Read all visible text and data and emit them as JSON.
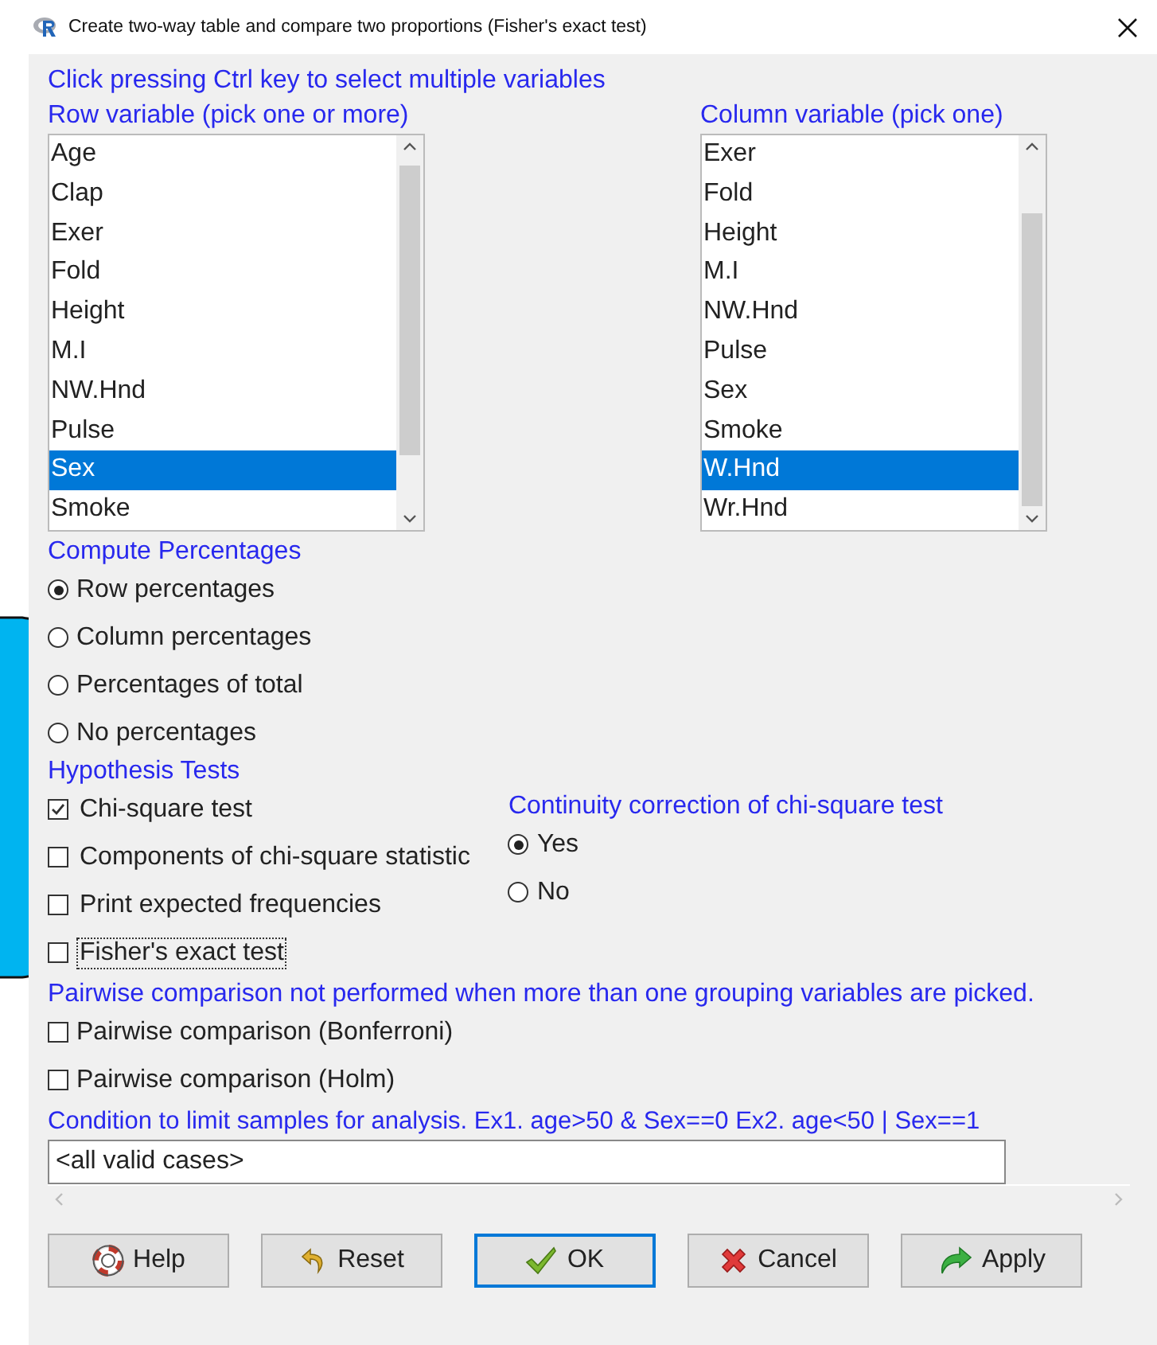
{
  "window": {
    "title": "Create two-way table and compare two proportions (Fisher's exact test)"
  },
  "instruction": "Click pressing Ctrl key to select multiple variables",
  "row_variable": {
    "label": "Row variable (pick one or more)",
    "items": [
      {
        "label": "Age",
        "selected": false
      },
      {
        "label": "Clap",
        "selected": false
      },
      {
        "label": "Exer",
        "selected": false
      },
      {
        "label": "Fold",
        "selected": false
      },
      {
        "label": "Height",
        "selected": false
      },
      {
        "label": "M.I",
        "selected": false
      },
      {
        "label": "NW.Hnd",
        "selected": false
      },
      {
        "label": "Pulse",
        "selected": false
      },
      {
        "label": "Sex",
        "selected": true
      },
      {
        "label": "Smoke",
        "selected": false
      }
    ]
  },
  "column_variable": {
    "label": "Column variable (pick one)",
    "items": [
      {
        "label": "Exer",
        "selected": false
      },
      {
        "label": "Fold",
        "selected": false
      },
      {
        "label": "Height",
        "selected": false
      },
      {
        "label": "M.I",
        "selected": false
      },
      {
        "label": "NW.Hnd",
        "selected": false
      },
      {
        "label": "Pulse",
        "selected": false
      },
      {
        "label": "Sex",
        "selected": false
      },
      {
        "label": "Smoke",
        "selected": false
      },
      {
        "label": "W.Hnd",
        "selected": true
      },
      {
        "label": "Wr.Hnd",
        "selected": false
      }
    ]
  },
  "percentages": {
    "label": "Compute Percentages",
    "options": [
      {
        "label": "Row percentages",
        "selected": true
      },
      {
        "label": "Column percentages",
        "selected": false
      },
      {
        "label": "Percentages of total",
        "selected": false
      },
      {
        "label": "No percentages",
        "selected": false
      }
    ]
  },
  "hypothesis": {
    "label": "Hypothesis Tests",
    "tests": [
      {
        "label": "Chi-square test",
        "checked": true,
        "focused": false
      },
      {
        "label": "Components of chi-square statistic",
        "checked": false,
        "focused": false
      },
      {
        "label": "Print expected frequencies",
        "checked": false,
        "focused": false
      },
      {
        "label": "Fisher's exact test",
        "checked": false,
        "focused": true
      }
    ]
  },
  "continuity": {
    "label": "Continuity correction of chi-square test",
    "options": [
      {
        "label": "Yes",
        "selected": true
      },
      {
        "label": "No",
        "selected": false
      }
    ]
  },
  "pairwise_note": "Pairwise comparison not performed when more than one grouping variables are picked.",
  "pairwise": [
    {
      "label": "Pairwise comparison (Bonferroni)",
      "checked": false
    },
    {
      "label": "Pairwise comparison (Holm)",
      "checked": false
    }
  ],
  "condition": {
    "label": "Condition to limit samples for analysis. Ex1. age>50 & Sex==0  Ex2. age<50 | Sex==1",
    "value": "<all valid cases>"
  },
  "buttons": [
    {
      "label": "Help",
      "kind": "help",
      "default": false
    },
    {
      "label": "Reset",
      "kind": "reset",
      "default": false
    },
    {
      "label": "OK",
      "kind": "ok",
      "default": true
    },
    {
      "label": "Cancel",
      "kind": "cancel",
      "default": false
    },
    {
      "label": "Apply",
      "kind": "apply",
      "default": false
    }
  ]
}
